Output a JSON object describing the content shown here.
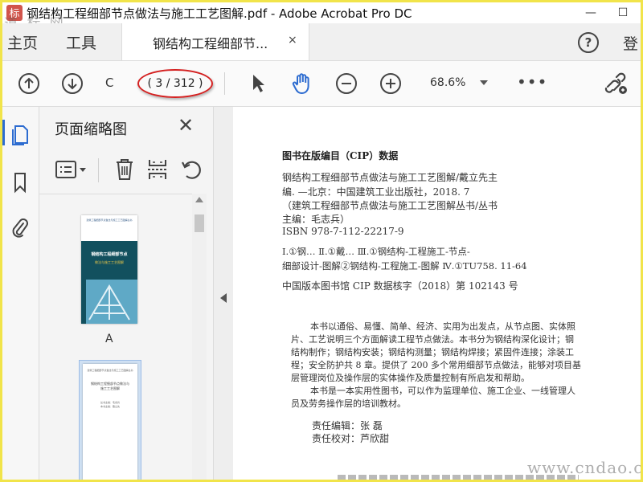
{
  "window": {
    "title": "钢结构工程细部节点做法与施工工艺图解.pdf - Adobe Acrobat Pro DC",
    "watermark_logo": "道 标 网",
    "controls": {
      "minimize": "—",
      "restore": "☐"
    }
  },
  "tabs": {
    "home_label": "主页",
    "tools_label": "工具",
    "doc_tab_label": "钢结构工程细部节...",
    "close_glyph": "×",
    "help_glyph": "?",
    "right_label": "登"
  },
  "toolbar": {
    "page_input_value": "C",
    "page_indicator": "( 3 / 312 )",
    "zoom_value": "68.6%",
    "more_glyph": "•••"
  },
  "colors": {
    "accent_blue": "#2d6cd0",
    "highlight_red": "#d42020",
    "frame_yellow": "#f1e44a"
  },
  "thumbnails": {
    "panel_title": "页面缩略图",
    "close_glyph": "✕",
    "items": [
      {
        "label": "A",
        "lines": [
          "建筑工程细部节点做法与施工工艺图解丛书",
          "钢结构工程细部节点",
          "做法与施工工艺图解"
        ]
      },
      {
        "label": "",
        "lines": [
          "建筑工程细部节点做法与施工工艺图解丛书",
          "钢结构工程细部节点做法与",
          "施工工艺图解",
          "丛书主编：毛志兵",
          "本书主编：戴立先"
        ]
      }
    ]
  },
  "document": {
    "cip_heading": "图书在版编目（CIP）数据",
    "cip_lines": [
      "钢结构工程细部节点做法与施工工艺图解/戴立先主",
      "编. —北京：中国建筑工业出版社，2018. 7",
      "（建筑工程细部节点做法与施工工艺图解丛书/丛书",
      "主编：毛志兵）",
      "ISBN 978-7-112-22217-9"
    ],
    "classification_lines": [
      "Ⅰ.①钢…   Ⅱ.①戴…   Ⅲ.①钢结构-工程施工-节点-",
      "细部设计-图解②钢结构-工程施工-图解   Ⅳ.①TU758. 11-64"
    ],
    "library_line": "中国版本图书馆 CIP 数据核字（2018）第 102143 号",
    "abstract_lines": [
      "本书以通俗、易懂、简单、经济、实用为出发点，从节点图、实体照",
      "片、工艺说明三个方面解读工程节点做法。本书分为钢结构深化设计；钢",
      "结构制作；钢结构安装；钢结构测量；钢结构焊接；紧固件连接；涂装工",
      "程；安全防护共 8 章。提供了 200 多个常用细部节点做法，能够对项目基",
      "层管理岗位及操作层的实体操作及质量控制有所启发和帮助。",
      "本书是一本实用性图书，可以作为监理单位、施工企业、一线管理人",
      "员及劳务操作层的培训教材。"
    ],
    "editor_line": "责任编辑：张   磊",
    "proof_line": "责任校对：芦欣甜",
    "footer_watermark": "www.cndao.com"
  }
}
